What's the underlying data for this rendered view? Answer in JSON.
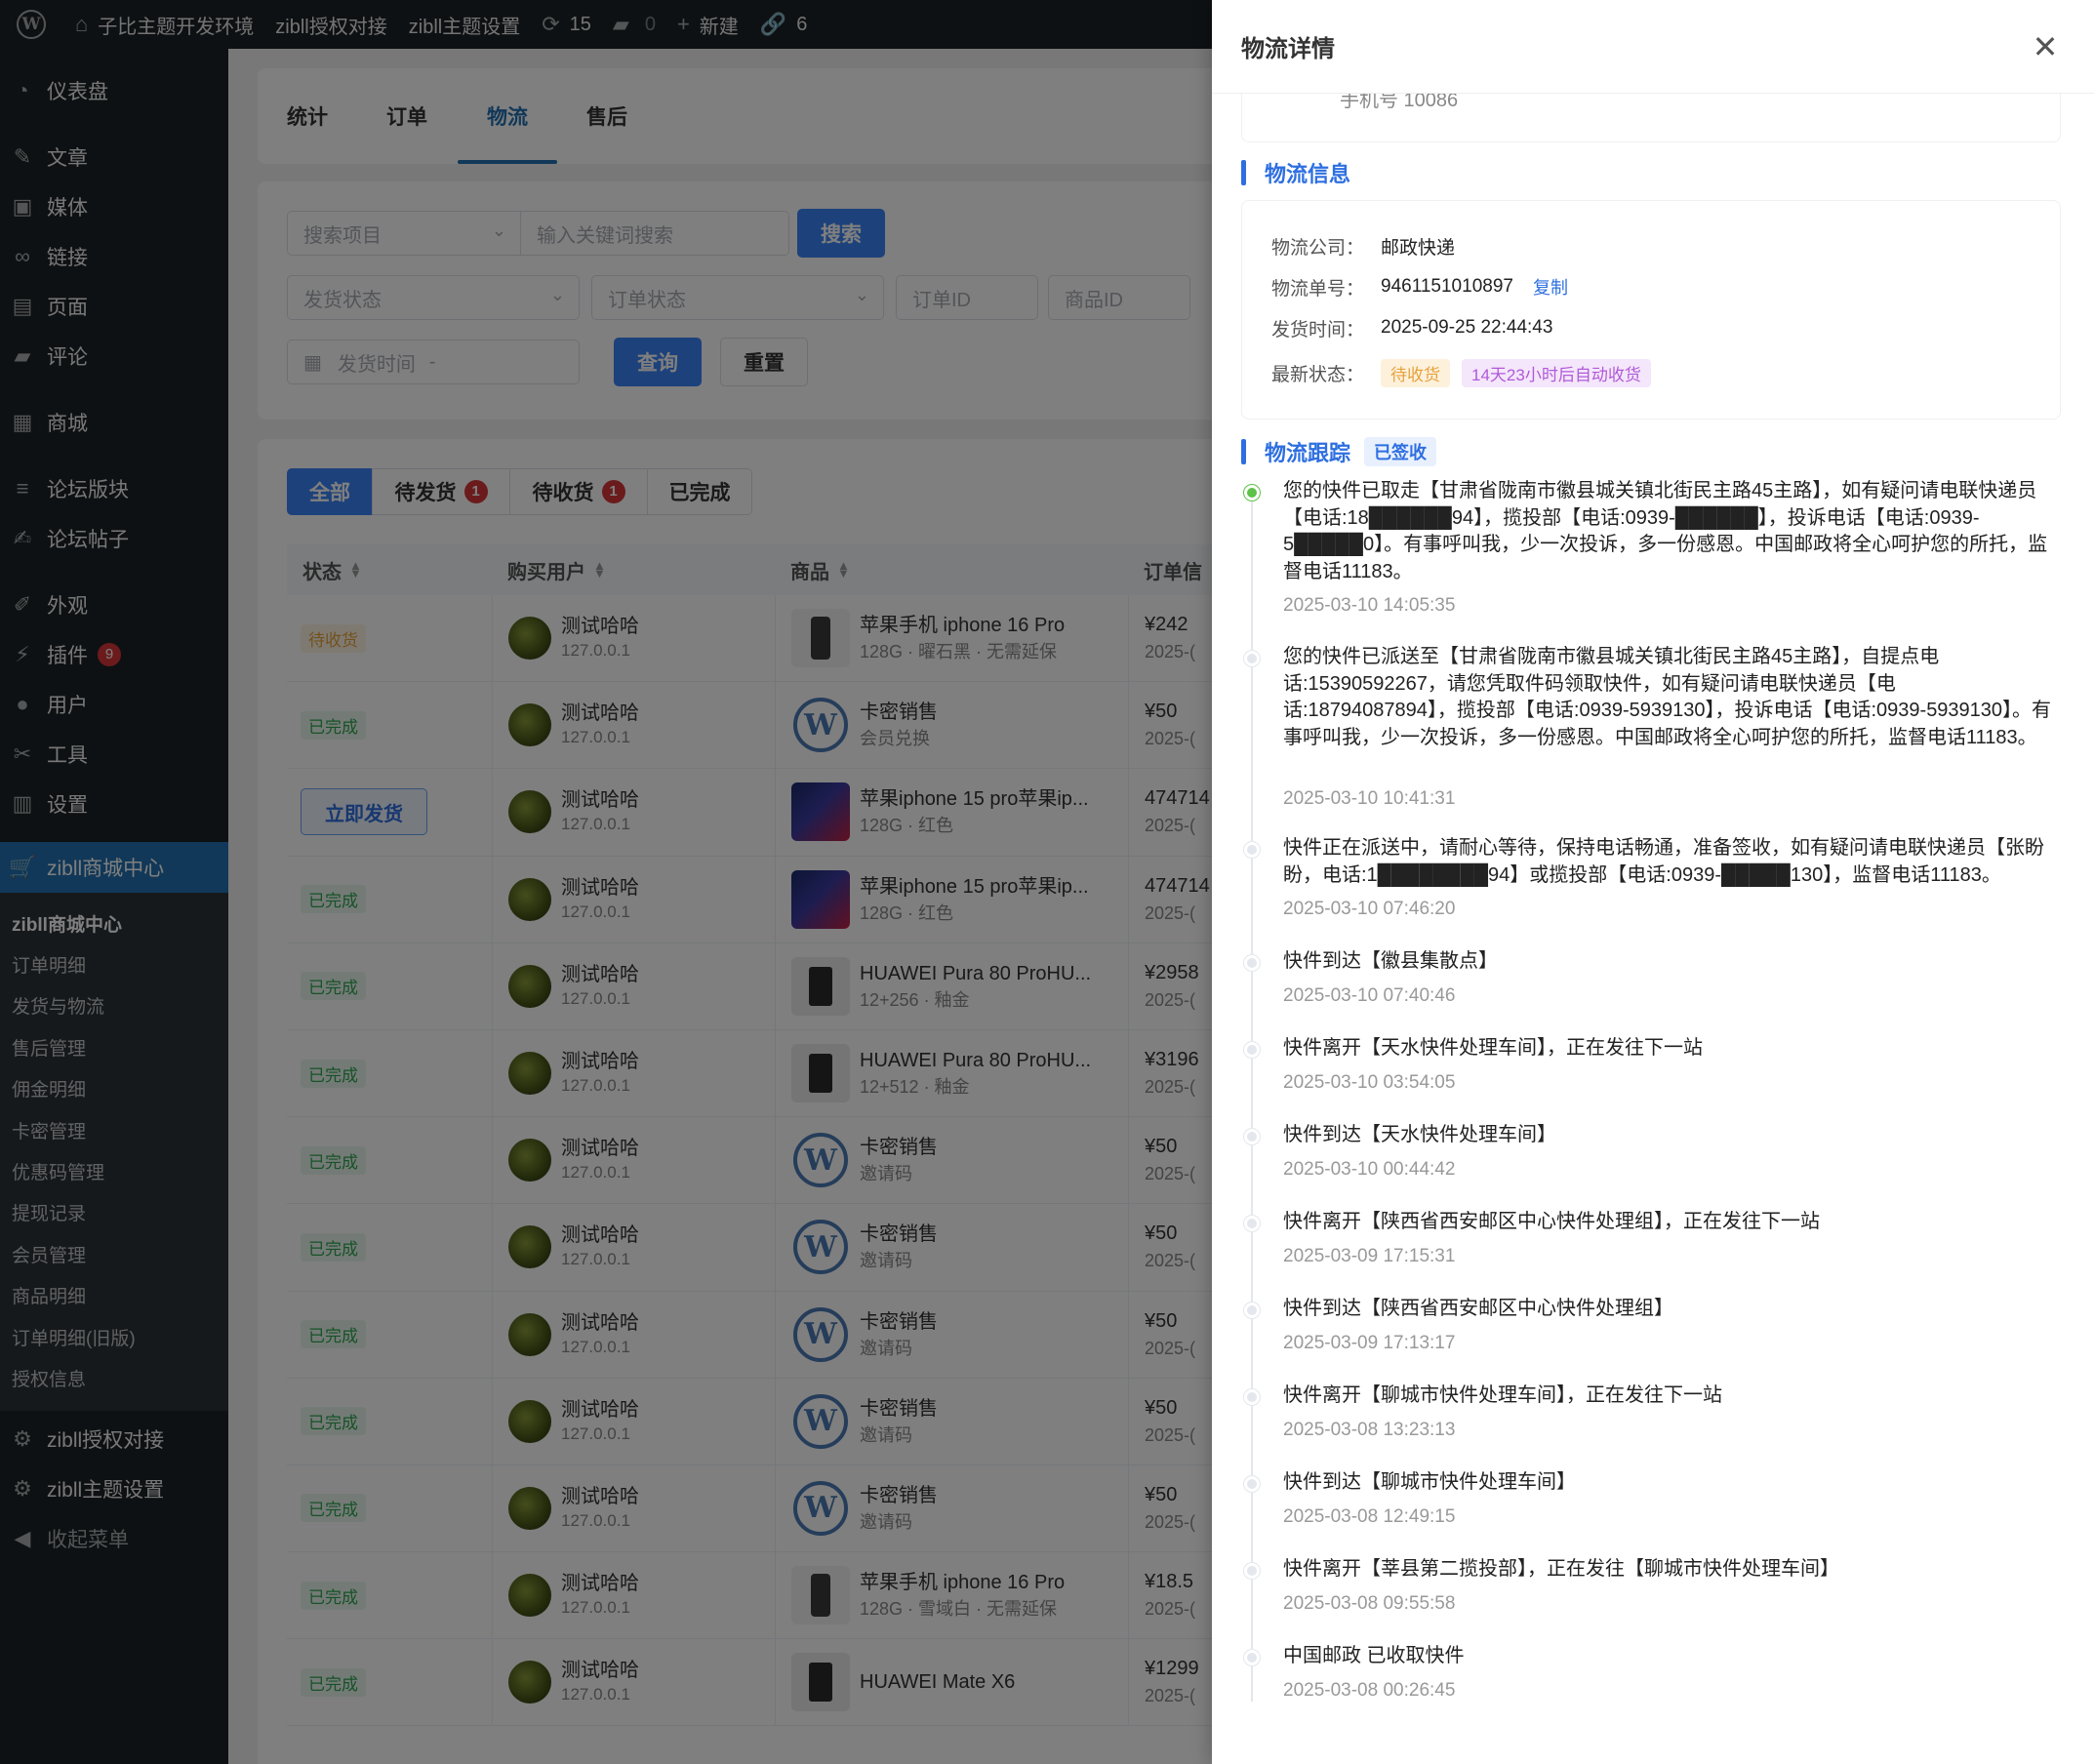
{
  "adminbar": {
    "site_name": "子比主题开发环境",
    "link1": "zibll授权对接",
    "link2": "zibll主题设置",
    "updates": "15",
    "comments": "0",
    "new_label": "新建",
    "links_count": "6"
  },
  "sidebar": {
    "items": [
      {
        "label": "仪表盘",
        "icon": "dashboard-icon"
      },
      {
        "label": "文章",
        "icon": "pin-icon"
      },
      {
        "label": "媒体",
        "icon": "media-icon"
      },
      {
        "label": "链接",
        "icon": "link-icon"
      },
      {
        "label": "页面",
        "icon": "page-icon"
      },
      {
        "label": "评论",
        "icon": "comment-icon"
      },
      {
        "label": "商城",
        "icon": "store-icon"
      },
      {
        "label": "论坛版块",
        "icon": "forum-icon"
      },
      {
        "label": "论坛帖子",
        "icon": "post-icon"
      },
      {
        "label": "外观",
        "icon": "appearance-icon"
      },
      {
        "label": "插件",
        "icon": "plugin-icon",
        "badge": "9"
      },
      {
        "label": "用户",
        "icon": "user-icon"
      },
      {
        "label": "工具",
        "icon": "tools-icon"
      },
      {
        "label": "设置",
        "icon": "settings-icon"
      },
      {
        "label": "zibll商城中心",
        "icon": "cart-icon"
      }
    ],
    "submenu": [
      "zibll商城中心",
      "订单明细",
      "发货与物流",
      "售后管理",
      "佣金明细",
      "卡密管理",
      "优惠码管理",
      "提现记录",
      "会员管理",
      "商品明细",
      "订单明细(旧版)",
      "授权信息"
    ],
    "bottom": [
      {
        "label": "zibll授权对接",
        "icon": "gear-icon"
      },
      {
        "label": "zibll主题设置",
        "icon": "gear-icon"
      },
      {
        "label": "收起菜单",
        "icon": "collapse-icon"
      }
    ]
  },
  "main": {
    "tabs": [
      "统计",
      "订单",
      "物流",
      "售后"
    ],
    "filters": {
      "search_item": "搜索项目",
      "keyword_placeholder": "输入关键词搜索",
      "search_btn": "搜索",
      "ship_status": "发货状态",
      "order_status": "订单状态",
      "order_id": "订单ID",
      "product_id": "商品ID",
      "ship_time": "发货时间",
      "ship_time_sep": "-",
      "query_btn": "查询",
      "reset_btn": "重置"
    },
    "status_tabs": [
      {
        "label": "全部"
      },
      {
        "label": "待发货",
        "badge": "1"
      },
      {
        "label": "待收货",
        "badge": "1"
      },
      {
        "label": "已完成"
      }
    ],
    "columns": [
      "状态",
      "购买用户",
      "商品",
      "订单信"
    ],
    "rows": [
      {
        "status": "待收货",
        "user": "测试哈哈",
        "ip": "127.0.0.1",
        "product": "苹果手机 iphone 16 Pro",
        "spec": "128G · 曜石黑 · 无需延保",
        "thumb": "phone",
        "price": "¥242",
        "date": "2025-("
      },
      {
        "status": "已完成",
        "user": "测试哈哈",
        "ip": "127.0.0.1",
        "product": "卡密销售",
        "spec": "会员兑换",
        "thumb": "wp",
        "price": "¥50",
        "date": "2025-("
      },
      {
        "status": "立即发货",
        "user": "测试哈哈",
        "ip": "127.0.0.1",
        "product": "苹果iphone 15 pro苹果ip...",
        "spec": "128G · 红色",
        "thumb": "blue",
        "price": "474714",
        "date": "2025-("
      },
      {
        "status": "已完成",
        "user": "测试哈哈",
        "ip": "127.0.0.1",
        "product": "苹果iphone 15 pro苹果ip...",
        "spec": "128G · 红色",
        "thumb": "blue",
        "price": "474714",
        "date": "2025-("
      },
      {
        "status": "已完成",
        "user": "测试哈哈",
        "ip": "127.0.0.1",
        "product": "HUAWEI Pura 80 ProHU...",
        "spec": "12+256 · 釉金",
        "thumb": "huawei",
        "price": "¥2958",
        "date": "2025-("
      },
      {
        "status": "已完成",
        "user": "测试哈哈",
        "ip": "127.0.0.1",
        "product": "HUAWEI Pura 80 ProHU...",
        "spec": "12+512 · 釉金",
        "thumb": "huawei",
        "price": "¥3196",
        "date": "2025-("
      },
      {
        "status": "已完成",
        "user": "测试哈哈",
        "ip": "127.0.0.1",
        "product": "卡密销售",
        "spec": "邀请码",
        "thumb": "wp",
        "price": "¥50",
        "date": "2025-("
      },
      {
        "status": "已完成",
        "user": "测试哈哈",
        "ip": "127.0.0.1",
        "product": "卡密销售",
        "spec": "邀请码",
        "thumb": "wp",
        "price": "¥50",
        "date": "2025-("
      },
      {
        "status": "已完成",
        "user": "测试哈哈",
        "ip": "127.0.0.1",
        "product": "卡密销售",
        "spec": "邀请码",
        "thumb": "wp",
        "price": "¥50",
        "date": "2025-("
      },
      {
        "status": "已完成",
        "user": "测试哈哈",
        "ip": "127.0.0.1",
        "product": "卡密销售",
        "spec": "邀请码",
        "thumb": "wp",
        "price": "¥50",
        "date": "2025-("
      },
      {
        "status": "已完成",
        "user": "测试哈哈",
        "ip": "127.0.0.1",
        "product": "卡密销售",
        "spec": "邀请码",
        "thumb": "wp",
        "price": "¥50",
        "date": "2025-("
      },
      {
        "status": "已完成",
        "user": "测试哈哈",
        "ip": "127.0.0.1",
        "product": "苹果手机 iphone 16 Pro",
        "spec": "128G · 雪域白 · 无需延保",
        "thumb": "phone",
        "price": "¥18.5",
        "date": "2025-("
      },
      {
        "status": "已完成",
        "user": "测试哈哈",
        "ip": "127.0.0.1",
        "product": "HUAWEI Mate X6",
        "spec": "",
        "thumb": "huawei",
        "price": "¥1299",
        "date": "2025-("
      }
    ]
  },
  "drawer": {
    "title": "物流详情",
    "prev_text": "手机号 10086",
    "info_title": "物流信息",
    "company_label": "物流公司：",
    "company": "邮政快递",
    "tracking_label": "物流单号：",
    "tracking": "9461151010897",
    "copy": "复制",
    "ship_time_label": "发货时间：",
    "ship_time": "2025-09-25 22:44:43",
    "latest_label": "最新状态：",
    "latest_status": "待收货",
    "auto_receive": "14天23小时后自动收货",
    "track_title": "物流跟踪",
    "track_tag": "已签收",
    "timeline": [
      {
        "text": "您的快件已取走【甘肃省陇南市徽县城关镇北街民主路45主路】，如有疑问请电联快递员【电话:18██████94】，揽投部【电话:0939-██████】，投诉电话【电话:0939-5█████0】。有事呼叫我，少一次投诉，多一份感恩。中国邮政将全心呵护您的所托，监督电话11183。",
        "time": "2025-03-10 14:05:35"
      },
      {
        "text": "您的快件已派送至【甘肃省陇南市徽县城关镇北街民主路45主路】，自提点电话:15390592267，请您凭取件码领取快件，如有疑问请电联快递员【电话:18794087894】，揽投部【电话:0939-5939130】，投诉电话【电话:0939-5939130】。有事呼叫我，少一次投诉，多一份感恩。中国邮政将全心呵护您的所托，监督电话11183。",
        "time": "2025-03-10 10:41:31"
      },
      {
        "text": "快件正在派送中，请耐心等待，保持电话畅通，准备签收，如有疑问请电联快递员【张盼盼，电话:1████████94】或揽投部【电话:0939-█████130】，监督电话11183。",
        "time": "2025-03-10 07:46:20"
      },
      {
        "text": "快件到达【徽县集散点】",
        "time": "2025-03-10 07:40:46"
      },
      {
        "text": "快件离开【天水快件处理车间】，正在发往下一站",
        "time": "2025-03-10 03:54:05"
      },
      {
        "text": "快件到达【天水快件处理车间】",
        "time": "2025-03-10 00:44:42"
      },
      {
        "text": "快件离开【陕西省西安邮区中心快件处理组】，正在发往下一站",
        "time": "2025-03-09 17:15:31"
      },
      {
        "text": "快件到达【陕西省西安邮区中心快件处理组】",
        "time": "2025-03-09 17:13:17"
      },
      {
        "text": "快件离开【聊城市快件处理车间】，正在发往下一站",
        "time": "2025-03-08 13:23:13"
      },
      {
        "text": "快件到达【聊城市快件处理车间】",
        "time": "2025-03-08 12:49:15"
      },
      {
        "text": "快件离开【莘县第二揽投部】，正在发往【聊城市快件处理车间】",
        "time": "2025-03-08 09:55:58"
      },
      {
        "text": "中国邮政 已收取快件",
        "time": "2025-03-08 00:26:45"
      }
    ]
  },
  "colors": {
    "primary": "#3b82f6",
    "wp_blue": "#2271b1",
    "sidebar_bg": "#1d2327",
    "success": "#2ea44f",
    "warning": "#e6a23c",
    "danger": "#d63638"
  }
}
